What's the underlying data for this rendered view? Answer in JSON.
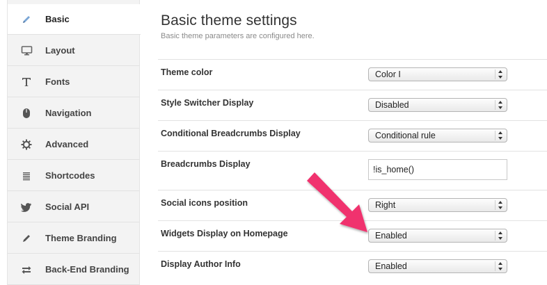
{
  "sidebar": {
    "items": [
      {
        "label": "Basic",
        "icon": "pencil-icon",
        "active": true
      },
      {
        "label": "Layout",
        "icon": "monitor-icon"
      },
      {
        "label": "Fonts",
        "icon": "text-t-icon"
      },
      {
        "label": "Navigation",
        "icon": "mouse-icon"
      },
      {
        "label": "Advanced",
        "icon": "gear-icon"
      },
      {
        "label": "Shortcodes",
        "icon": "list-icon"
      },
      {
        "label": "Social API",
        "icon": "bird-icon"
      },
      {
        "label": "Theme Branding",
        "icon": "pencil-icon"
      },
      {
        "label": "Back-End Branding",
        "icon": "swap-arrows-icon"
      }
    ]
  },
  "main": {
    "title": "Basic theme settings",
    "subtitle": "Basic theme parameters are configured here.",
    "settings": [
      {
        "label": "Theme color",
        "type": "select",
        "value": "Color I"
      },
      {
        "label": "Style Switcher Display",
        "type": "select",
        "value": "Disabled"
      },
      {
        "label": "Conditional Breadcrumbs Display",
        "type": "select",
        "value": "Conditional rule"
      },
      {
        "label": "Breadcrumbs Display",
        "type": "text",
        "value": "!is_home()"
      },
      {
        "label": "Social icons position",
        "type": "select",
        "value": "Right"
      },
      {
        "label": "Widgets Display on Homepage",
        "type": "select",
        "value": "Enabled"
      },
      {
        "label": "Display Author Info",
        "type": "select",
        "value": "Enabled"
      }
    ]
  },
  "colors": {
    "annotation_arrow": "#f0316e",
    "sidebar_bg": "#f3f3f3"
  }
}
